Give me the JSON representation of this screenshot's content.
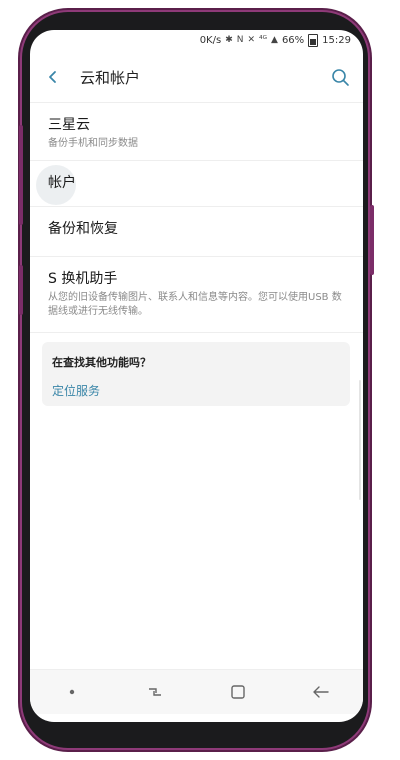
{
  "status": {
    "speed": "0K/s",
    "icons": [
      "bluetooth-icon",
      "nfc-icon",
      "mute-icon",
      "4g-icon",
      "signal-icon",
      "battery-icon"
    ],
    "battery": "66%",
    "time": "15:29"
  },
  "appbar": {
    "title": "云和帐户"
  },
  "items": [
    {
      "title": "三星云",
      "subtitle": "备份手机和同步数据"
    },
    {
      "title": "帐户"
    },
    {
      "title": "备份和恢复"
    },
    {
      "title": "S 换机助手",
      "subtitle": "从您的旧设备传输图片、联系人和信息等内容。您可以使用USB 数据线或进行无线传输。"
    }
  ],
  "card": {
    "title": "在查找其他功能吗？",
    "link": "定位服务"
  },
  "colors": {
    "accent": "#3a86a8",
    "frame": "#8e3a78"
  }
}
